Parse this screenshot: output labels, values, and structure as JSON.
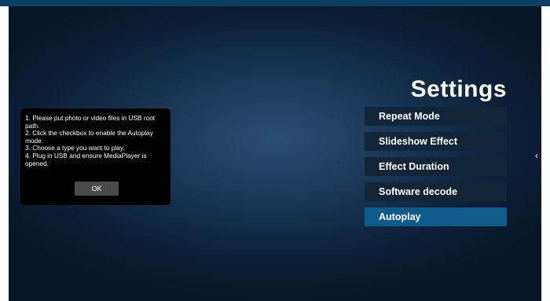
{
  "settings": {
    "title": "Settings",
    "menu": [
      {
        "label": "Repeat Mode",
        "selected": false
      },
      {
        "label": "Slideshow Effect",
        "selected": false
      },
      {
        "label": "Effect Duration",
        "selected": false
      },
      {
        "label": "Software decode",
        "selected": false
      },
      {
        "label": "Autoplay",
        "selected": true
      }
    ]
  },
  "dialog": {
    "lines": [
      "1. Please put photo or video files in USB root path.",
      "2. Click the checkbox to enable the Autoplay mode.",
      "3. Choose a type you want to play.",
      "4. Plug in USB and ensure MediaPlayer is opened."
    ],
    "ok_label": "OK"
  },
  "nav": {
    "left_icon": "chevron-right-icon",
    "right_icon": "chevron-left-icon"
  },
  "colors": {
    "top_bar": "#0d3d63",
    "menu_item_bg": "#132538",
    "menu_item_selected_bg": "#0e5b8c",
    "dialog_bg": "#000000",
    "ok_button_bg": "#4a4a4a"
  }
}
